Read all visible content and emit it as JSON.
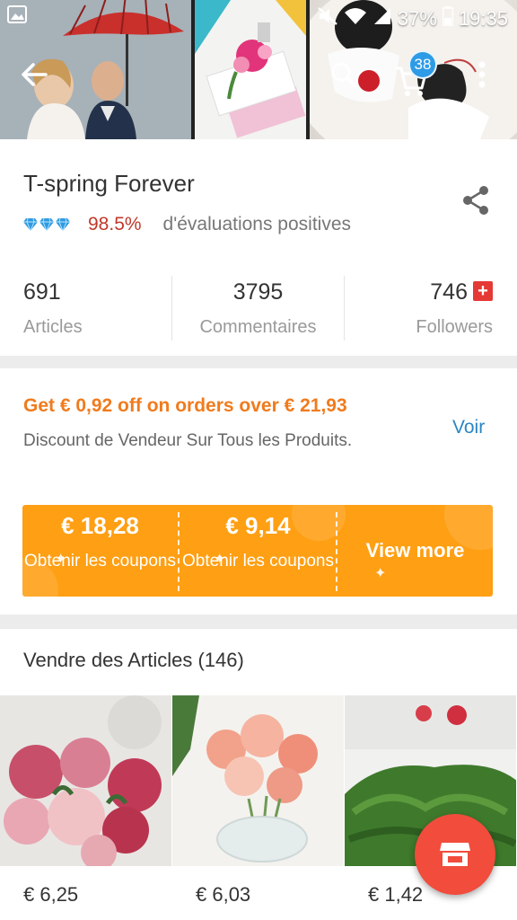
{
  "status_bar": {
    "battery": "37%",
    "time": "19:35"
  },
  "app_bar": {
    "cart_count": "38"
  },
  "store": {
    "name": "T-spring Forever",
    "rating_percent": "98.5%",
    "rating_text": "d'évaluations positives",
    "diamond_count": 3
  },
  "stats": [
    {
      "value": "691",
      "label": "Articles"
    },
    {
      "value": "3795",
      "label": "Commentaires"
    },
    {
      "value": "746",
      "label": "Followers"
    }
  ],
  "offer": {
    "title": "Get € 0,92 off on orders over € 21,93",
    "subtitle": "Discount de Vendeur Sur Tous les Produits.",
    "link": "Voir"
  },
  "coupons": [
    {
      "amount": "€ 18,28",
      "label": "Obtenir les coupons"
    },
    {
      "amount": "€ 9,14",
      "label": "Obtenir les coupons"
    }
  ],
  "view_more": "View more",
  "products_section": {
    "title": "Vendre des Articles (146)",
    "items": [
      {
        "price": "€ 6,25"
      },
      {
        "price": "€ 6,03"
      },
      {
        "price": "€ 1,42"
      }
    ]
  },
  "colors": {
    "accent_orange": "#f07b1d",
    "coupon_bg": "#ff9f13",
    "rating_red": "#c0392b",
    "link_blue": "#2a86c5",
    "fab_red": "#f14c3c",
    "badge_blue": "#2e9be6"
  },
  "icons": [
    "back-arrow-icon",
    "search-icon",
    "cart-icon",
    "more-vert-icon",
    "share-icon",
    "diamond-icon",
    "plus-icon",
    "store-icon",
    "image-notification-icon",
    "mute-icon",
    "wifi-icon",
    "signal-icon",
    "battery-icon"
  ]
}
